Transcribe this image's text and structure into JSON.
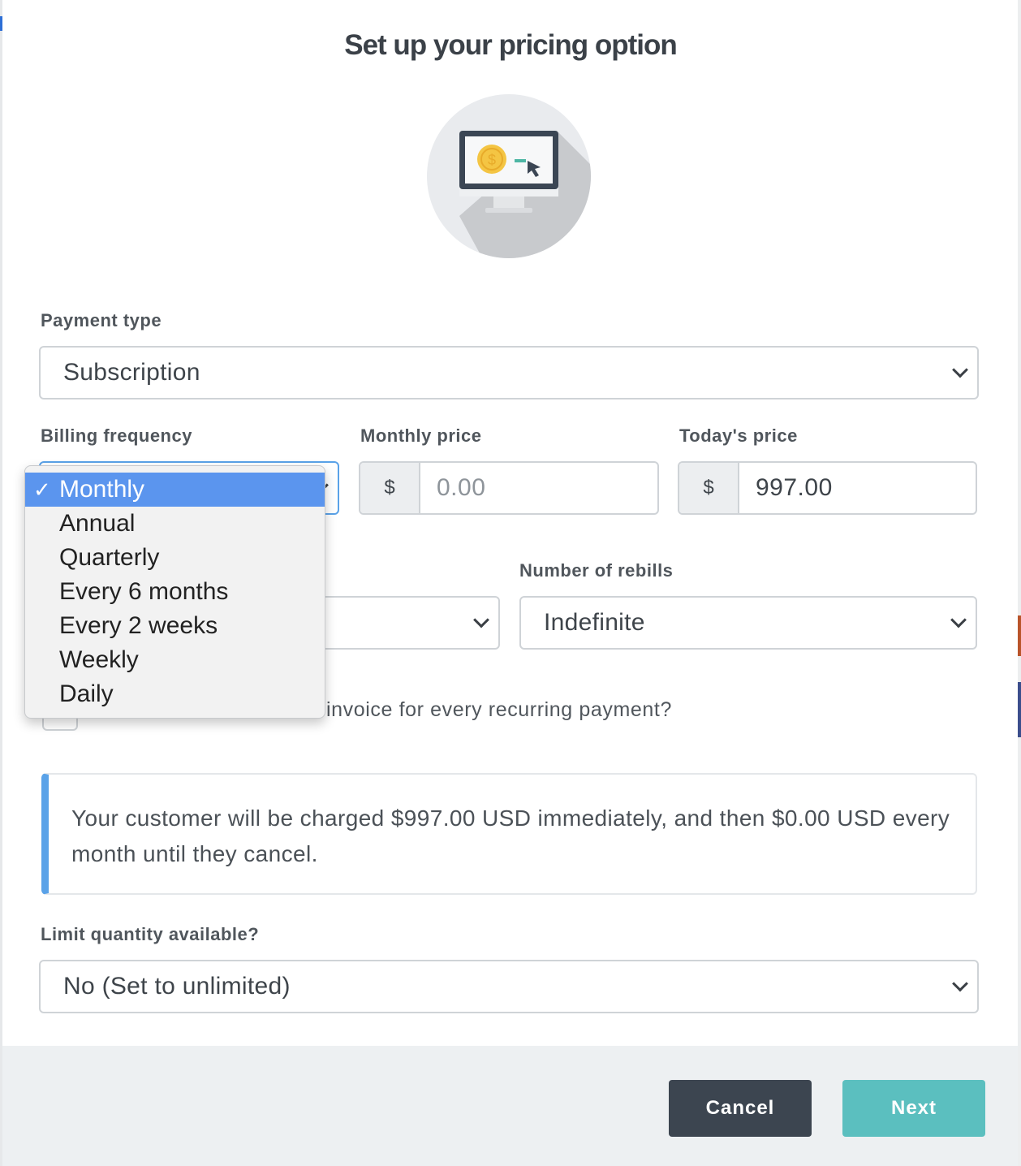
{
  "title": "Set up your pricing option",
  "payment_type": {
    "label": "Payment type",
    "value": "Subscription"
  },
  "billing_frequency": {
    "label": "Billing frequency",
    "options": [
      "Monthly",
      "Annual",
      "Quarterly",
      "Every 6 months",
      "Every 2 weeks",
      "Weekly",
      "Daily"
    ],
    "selected": "Monthly",
    "check_mark": "✓"
  },
  "monthly_price": {
    "label": "Monthly price",
    "currency": "$",
    "placeholder": "0.00"
  },
  "todays_price": {
    "label": "Today's price",
    "currency": "$",
    "value": "997.00"
  },
  "rebills": {
    "label": "Number of rebills",
    "value": "Indefinite"
  },
  "invoice_checkbox": {
    "label_visible": "invoice for every recurring payment?"
  },
  "info_message": "Your customer will be charged $997.00 USD immediately, and then $0.00 USD every month until they cancel.",
  "limit_quantity": {
    "label": "Limit quantity available?",
    "value": "No (Set to unlimited)"
  },
  "footer": {
    "cancel_label": "Cancel",
    "next_label": "Next"
  },
  "colors": {
    "accent_blue": "#5aa2e8",
    "selected_option": "#5b95ee",
    "next_button": "#5bbfbf",
    "cancel_button": "#3c4550",
    "coin": "#f4c543"
  }
}
